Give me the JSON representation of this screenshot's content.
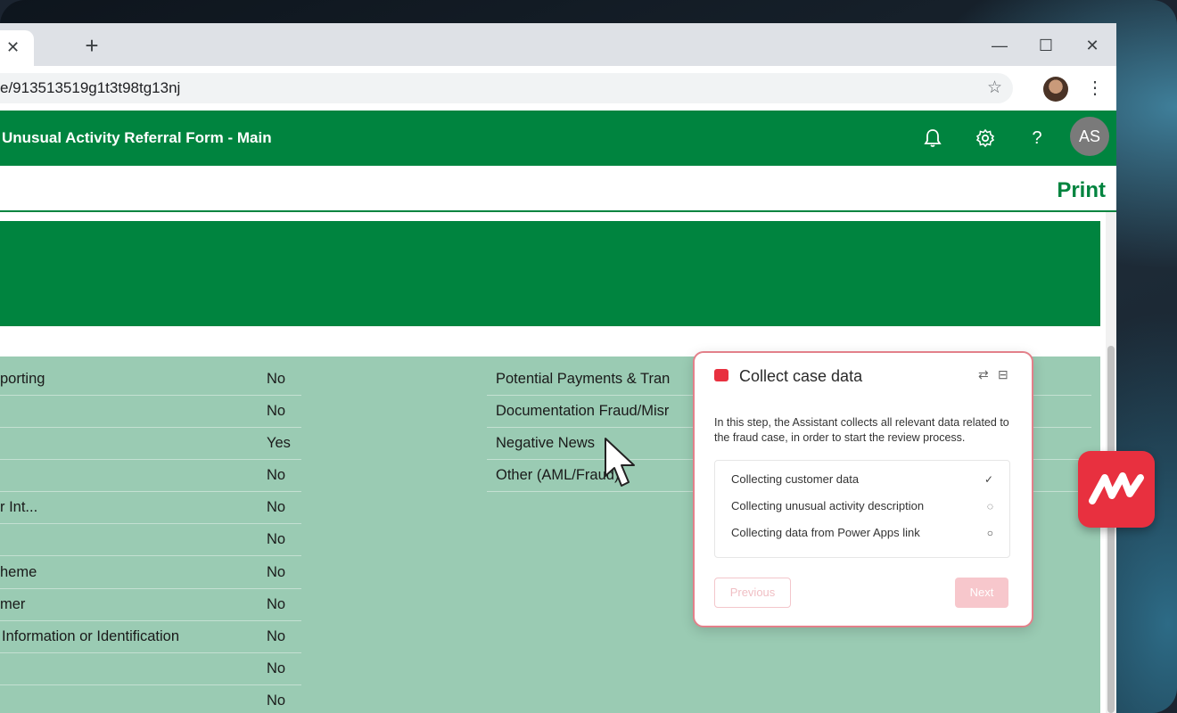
{
  "browser": {
    "tab_close_glyph": "✕",
    "new_tab_glyph": "+",
    "url": "e/913513519g1t3t98tg13nj",
    "star_glyph": "☆",
    "menu_glyph": "⋮",
    "window": {
      "minimize": "—",
      "maximize": "☐",
      "close": "✕"
    }
  },
  "app": {
    "title": "Unusual Activity Referral Form - Main",
    "avatar_initials": "AS",
    "help_glyph": "?",
    "print_label": "Print",
    "brand_color": "#00843f"
  },
  "form": {
    "left_rows": [
      {
        "label": "porting",
        "value": "No"
      },
      {
        "label": "",
        "value": "No"
      },
      {
        "label": "",
        "value": "Yes"
      },
      {
        "label": "",
        "value": "No"
      },
      {
        "label": "r Int...",
        "value": "No"
      },
      {
        "label": "",
        "value": "No"
      },
      {
        "label": "heme",
        "value": "No"
      },
      {
        "label": "mer",
        "value": "No"
      },
      {
        "label": "Information or Identification",
        "value": "No"
      },
      {
        "label": "",
        "value": "No"
      },
      {
        "label": "",
        "value": "No"
      }
    ],
    "right_rows": [
      {
        "label": "Potential Payments & Tran"
      },
      {
        "label": "Documentation Fraud/Misr"
      },
      {
        "label": "Negative News"
      },
      {
        "label": "Other (AML/Fraud)"
      }
    ]
  },
  "assistant": {
    "title": "Collect case data",
    "description": "In this step, the Assistant collects all relevant data related to the fraud case, in order to start the review process.",
    "steps": [
      {
        "label": "Collecting customer data",
        "state": "✓"
      },
      {
        "label": "Collecting unusual activity description",
        "state": "◌"
      },
      {
        "label": "Collecting data from Power Apps link",
        "state": "○"
      }
    ],
    "previous_label": "Previous",
    "next_label": "Next",
    "accent_color": "#e8303f"
  }
}
